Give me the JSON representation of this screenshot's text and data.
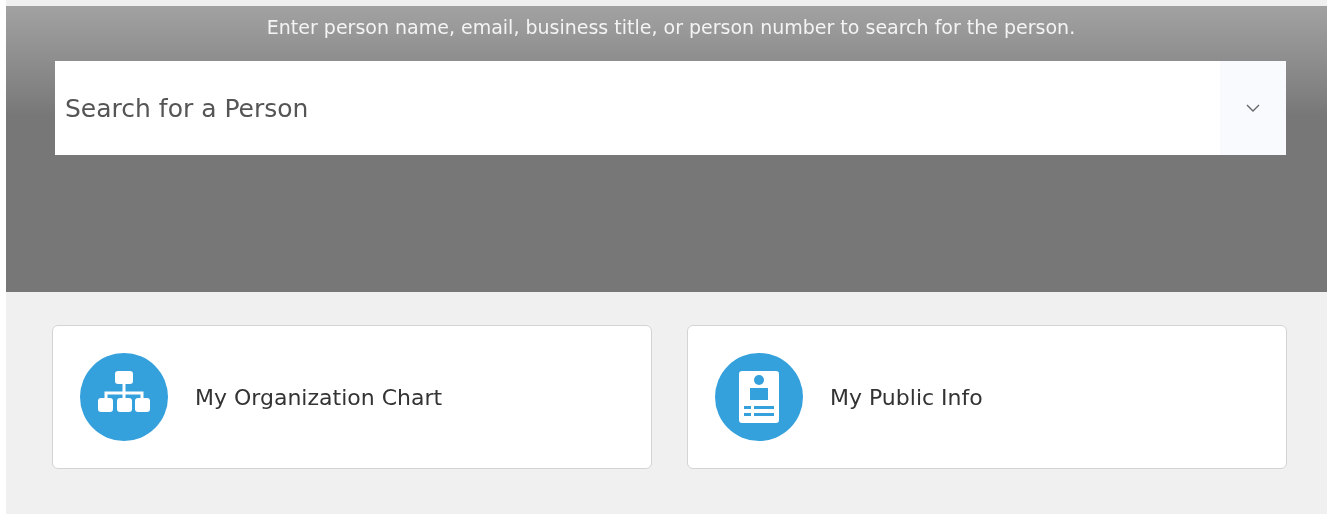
{
  "search": {
    "hint": "Enter person name, email, business title, or person number to search for the person.",
    "placeholder": "Search for a Person"
  },
  "cards": [
    {
      "label": "My Organization Chart",
      "kind": "org"
    },
    {
      "label": "My Public Info",
      "kind": "card"
    }
  ]
}
